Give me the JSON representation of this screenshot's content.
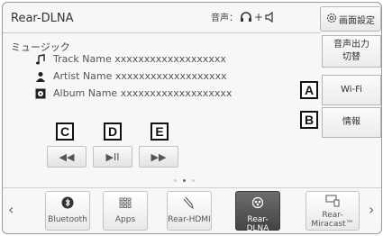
{
  "header": {
    "title": "Rear-DLNA",
    "audio_label": "音声：",
    "settings_label": "画面設定"
  },
  "source_label": "ミュージック",
  "track": {
    "name": "Track Name xxxxxxxxxxxxxxxxxxx",
    "artist": "Artist Name xxxxxxxxxxxxxxxxxxx",
    "album": "Album Name xxxxxxxxxxxxxxxxxxx"
  },
  "controls": {
    "prev": "◀◀",
    "play_pause": "▶II",
    "next": "▶▶"
  },
  "callouts": {
    "a": "A",
    "b": "B",
    "c": "C",
    "d": "D",
    "e": "E"
  },
  "side": {
    "audio_output": "音声出力\n切替",
    "wifi": "Wi-Fi",
    "info": "情報"
  },
  "pager": {
    "pages": 3,
    "current": 2
  },
  "dock": {
    "apps": [
      {
        "label": "Bluetooth",
        "icon": "bluetooth-icon",
        "active": false
      },
      {
        "label": "Apps",
        "icon": "apps-grid-icon",
        "active": false
      },
      {
        "label": "Rear-HDMI",
        "icon": "hdmi-cable-icon",
        "active": false
      },
      {
        "label": "Rear-DLNA",
        "icon": "dlna-icon",
        "active": true
      },
      {
        "label": "Rear-\nMiracast™",
        "icon": "miracast-icon",
        "active": false
      }
    ],
    "prev_arrow": "‹",
    "next_arrow": "›"
  },
  "colors": {
    "active_tile": "#555555",
    "panel": "#f7f7f7",
    "callout_border": "#111111"
  }
}
